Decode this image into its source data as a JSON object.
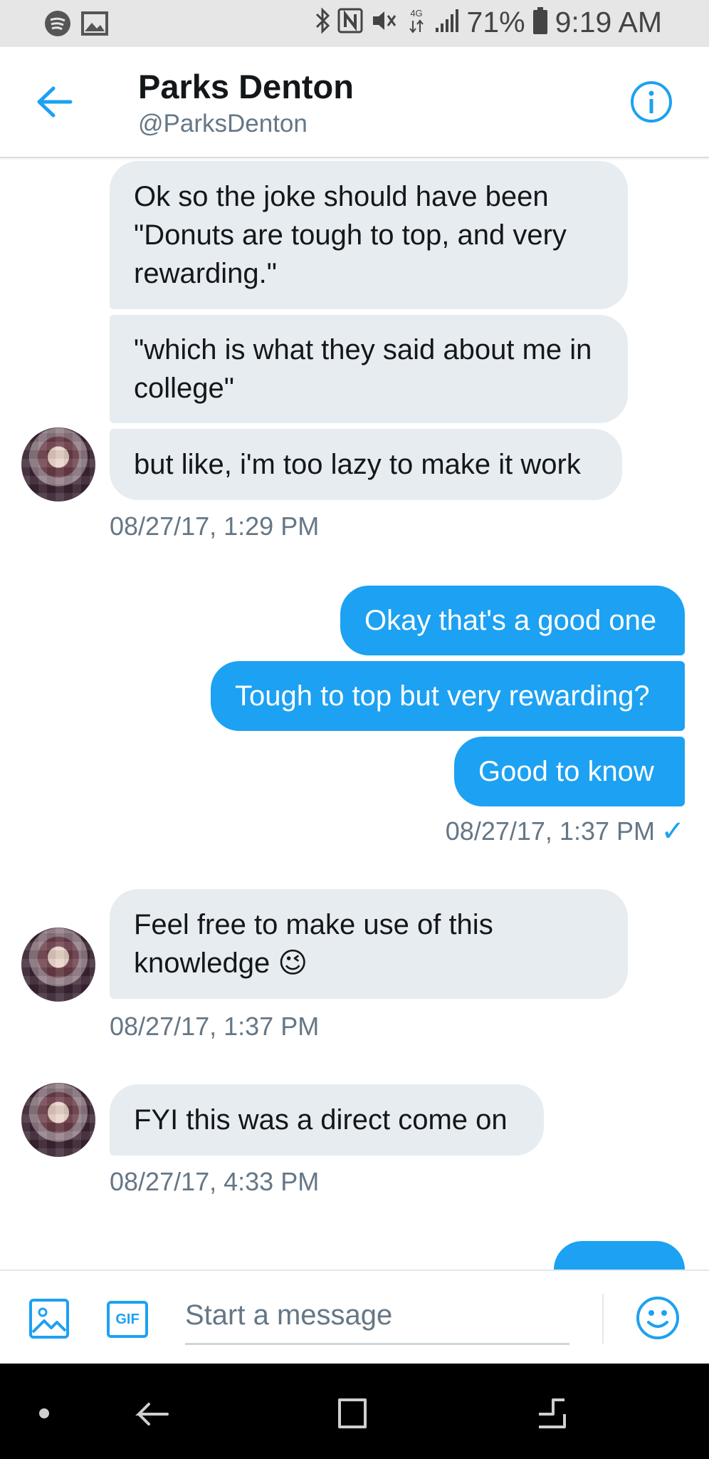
{
  "status_bar": {
    "battery": "71%",
    "time": "9:19 AM",
    "network": "4G"
  },
  "header": {
    "name": "Parks Denton",
    "handle": "@ParksDenton"
  },
  "messages": [
    {
      "text": "Ok so the joke should have been \"Donuts are tough to top, and very rewarding.\""
    },
    {
      "text": "\"which is what they said about me in college\""
    },
    {
      "text": "but like, i'm too lazy to make it work"
    },
    {
      "timestamp": "08/27/17, 1:29 PM"
    },
    {
      "text": "Okay that's a good one"
    },
    {
      "text": "Tough to top but very rewarding?"
    },
    {
      "text": "Good to know"
    },
    {
      "timestamp": "08/27/17, 1:37 PM",
      "read_mark": "✓"
    },
    {
      "text": "Feel free to make use of this knowledge 😉"
    },
    {
      "timestamp": "08/27/17, 1:37 PM"
    },
    {
      "text": "FYI this was a direct come on"
    },
    {
      "timestamp": "08/27/17, 4:33 PM"
    }
  ],
  "composer": {
    "placeholder": "Start a message",
    "gif_label": "GIF"
  },
  "colors": {
    "accent": "#1da1f2",
    "received_bubble": "#e6ecf0",
    "timestamp": "#657786"
  }
}
